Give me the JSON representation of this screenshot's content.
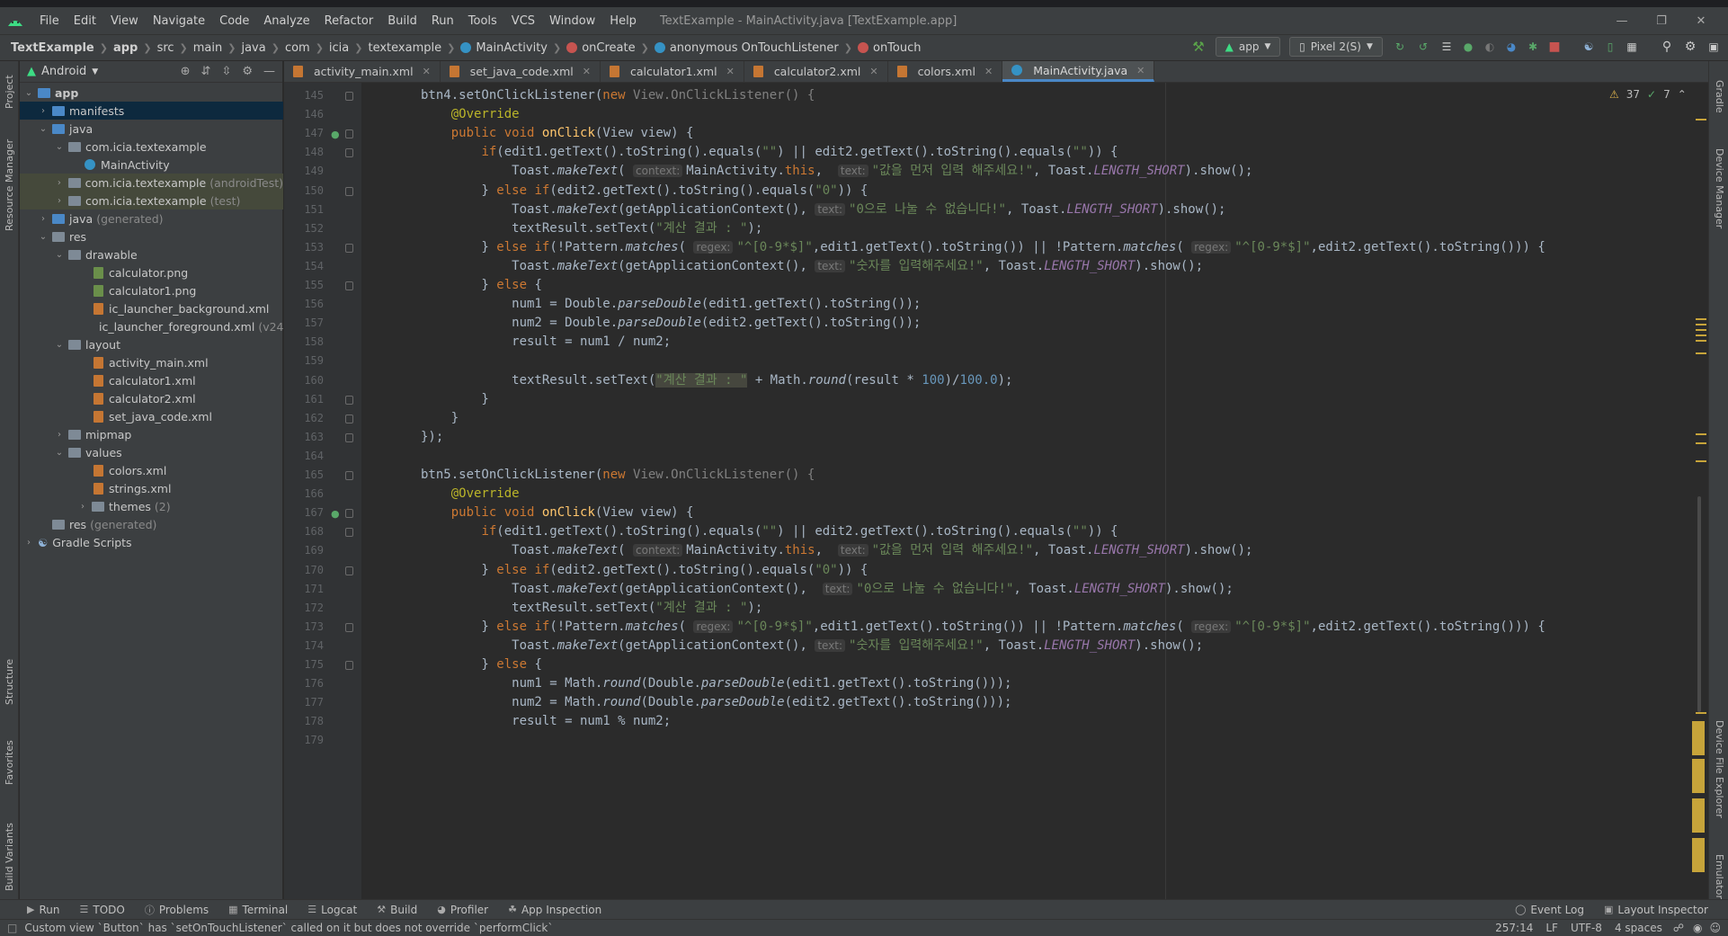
{
  "menubar": {
    "items": [
      "File",
      "Edit",
      "View",
      "Navigate",
      "Code",
      "Analyze",
      "Refactor",
      "Build",
      "Run",
      "Tools",
      "VCS",
      "Window",
      "Help"
    ],
    "window_title": "TextExample - MainActivity.java [TextExample.app]"
  },
  "breadcrumbs": [
    "TextExample",
    "app",
    "src",
    "main",
    "java",
    "com",
    "icia",
    "textexample",
    "MainActivity",
    "onCreate",
    "anonymous OnTouchListener",
    "onTouch"
  ],
  "toolbar": {
    "run_config": "app",
    "device": "Pixel 2(S)"
  },
  "project": {
    "view": "Android",
    "tree": [
      {
        "label": "app",
        "dim": ""
      },
      {
        "label": "manifests",
        "dim": ""
      },
      {
        "label": "java",
        "dim": ""
      },
      {
        "label": "com.icia.textexample",
        "dim": ""
      },
      {
        "label": "MainActivity",
        "dim": ""
      },
      {
        "label": "com.icia.textexample",
        "dim": "(androidTest)"
      },
      {
        "label": "com.icia.textexample",
        "dim": "(test)"
      },
      {
        "label": "java",
        "dim": "(generated)"
      },
      {
        "label": "res",
        "dim": ""
      },
      {
        "label": "drawable",
        "dim": ""
      },
      {
        "label": "calculator.png",
        "dim": ""
      },
      {
        "label": "calculator1.png",
        "dim": ""
      },
      {
        "label": "ic_launcher_background.xml",
        "dim": ""
      },
      {
        "label": "ic_launcher_foreground.xml",
        "dim": "(v24)"
      },
      {
        "label": "layout",
        "dim": ""
      },
      {
        "label": "activity_main.xml",
        "dim": ""
      },
      {
        "label": "calculator1.xml",
        "dim": ""
      },
      {
        "label": "calculator2.xml",
        "dim": ""
      },
      {
        "label": "set_java_code.xml",
        "dim": ""
      },
      {
        "label": "mipmap",
        "dim": ""
      },
      {
        "label": "values",
        "dim": ""
      },
      {
        "label": "colors.xml",
        "dim": ""
      },
      {
        "label": "strings.xml",
        "dim": ""
      },
      {
        "label": "themes",
        "dim": "(2)"
      },
      {
        "label": "res",
        "dim": "(generated)"
      },
      {
        "label": "Gradle Scripts",
        "dim": ""
      }
    ]
  },
  "tabs": [
    "activity_main.xml",
    "set_java_code.xml",
    "calculator1.xml",
    "calculator2.xml",
    "colors.xml",
    "MainActivity.java"
  ],
  "inspection": {
    "warnings": "37",
    "ok": "7"
  },
  "editor": {
    "line_numbers": [
      "145",
      "146",
      "147",
      "148",
      "149",
      "150",
      "151",
      "152",
      "153",
      "154",
      "155",
      "156",
      "157",
      "158",
      "159",
      "160",
      "161",
      "162",
      "163",
      "164",
      "165",
      "166",
      "167",
      "168",
      "169",
      "170",
      "171",
      "172",
      "173",
      "174",
      "175",
      "176",
      "177",
      "178",
      "179"
    ],
    "hints": {
      "context": "context:",
      "text": "text:",
      "regex": "regex:"
    },
    "strings": {
      "empty": "\"\"",
      "enter_value": "\"값을 먼저 입력 해주세요!\"",
      "zero": "\"0\"",
      "no_div_zero": "\"0으로 나눌 수 없습니다!\"",
      "result_label": "\"계산 결과 : \"",
      "regex": "\"^[0-9*$]\"",
      "enter_number": "\"숫자를 입력해주세요!\""
    },
    "numbers": {
      "hundred": "100",
      "hundred_f": "100.0"
    }
  },
  "left_tools": [
    "Project",
    "Resource Manager",
    "Structure",
    "Favorites",
    "Build Variants"
  ],
  "right_tools": [
    "Gradle",
    "Device Manager",
    "Device File Explorer",
    "Emulator"
  ],
  "bottom_tools": [
    "Run",
    "TODO",
    "Problems",
    "Terminal",
    "Logcat",
    "Build",
    "Profiler",
    "App Inspection"
  ],
  "bottom_right_tools": [
    "Event Log",
    "Layout Inspector"
  ],
  "status": {
    "message": "Custom view `Button` has `setOnTouchListener` called on it but does not override `performClick`",
    "position": "257:14",
    "line_sep": "LF",
    "encoding": "UTF-8",
    "indent": "4 spaces"
  }
}
